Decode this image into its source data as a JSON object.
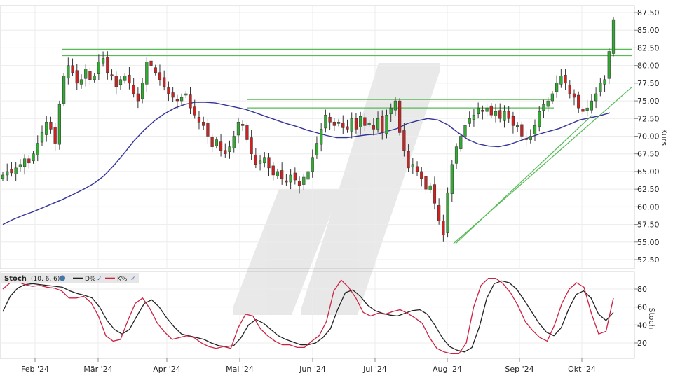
{
  "chart_data": [
    {
      "type": "candlestick",
      "title": "",
      "ylabel": "Kurs",
      "ylim": [
        51.5,
        88.5
      ],
      "yticks": [
        52.5,
        55,
        57.5,
        60,
        62.5,
        65,
        67.5,
        70,
        72.5,
        75,
        77.5,
        80,
        82.5,
        85,
        87.5
      ],
      "ytick_labels": [
        "52.50",
        "55.00",
        "57.50",
        "60.00",
        "62.50",
        "65.00",
        "67.50",
        "70.00",
        "72.50",
        "75.00",
        "77.50",
        "80.00",
        "82.50",
        "85.00",
        "87.50"
      ],
      "xlabels": [
        "Feb '24",
        "Mär '24",
        "Apr '24",
        "Mai '24",
        "Jun '24",
        "Jul '24",
        "Aug '24",
        "Sep '24",
        "Okt '24"
      ],
      "grid": true,
      "colors": {
        "up": "#33aa33",
        "down": "#cc2222",
        "ma": "#333399",
        "lines": "#55bb55"
      },
      "close_series": [
        64.5,
        65.0,
        64.8,
        65.5,
        66.0,
        66.8,
        66.2,
        67.5,
        69.0,
        70.5,
        72.0,
        71.0,
        69.0,
        74.5,
        78.5,
        80.0,
        79.0,
        77.5,
        78.0,
        79.5,
        78.0,
        78.5,
        80.5,
        81.0,
        79.0,
        78.5,
        77.0,
        78.0,
        78.5,
        77.5,
        76.0,
        75.0,
        77.5,
        80.5,
        80.0,
        79.0,
        78.0,
        77.0,
        76.0,
        75.5,
        75.0,
        75.5,
        76.0,
        74.0,
        73.0,
        72.0,
        71.5,
        70.0,
        68.5,
        69.5,
        68.0,
        67.5,
        68.5,
        70.0,
        72.0,
        71.5,
        69.5,
        67.5,
        66.0,
        66.5,
        67.0,
        65.5,
        64.5,
        65.0,
        64.0,
        63.5,
        64.5,
        63.8,
        63.0,
        64.2,
        65.0,
        67.0,
        69.0,
        71.0,
        73.0,
        72.0,
        71.5,
        72.0,
        71.2,
        71.0,
        72.5,
        71.0,
        72.8,
        71.5,
        71.8,
        71.0,
        72.5,
        70.5,
        73.0,
        74.0,
        75.0,
        70.5,
        68.0,
        65.5,
        66.0,
        65.0,
        64.0,
        62.5,
        63.0,
        60.5,
        58.0,
        56.0,
        62.0,
        66.0,
        68.5,
        70.0,
        71.5,
        72.5,
        73.0,
        74.0,
        73.5,
        74.0,
        73.0,
        73.5,
        72.5,
        73.5,
        72.5,
        71.5,
        71.5,
        70.0,
        69.5,
        70.0,
        71.5,
        73.5,
        74.5,
        75.0,
        76.0,
        77.5,
        78.5,
        77.5,
        76.0,
        75.5,
        74.0,
        73.5,
        74.0,
        75.0,
        76.0,
        77.5,
        78.0,
        82.0,
        86.5
      ],
      "ma_series": [
        57.5,
        58.2,
        58.8,
        59.3,
        59.9,
        60.5,
        61.1,
        61.8,
        62.5,
        63.3,
        64.4,
        65.9,
        67.6,
        69.4,
        70.9,
        72.2,
        73.2,
        74.0,
        74.5,
        74.8,
        74.8,
        74.7,
        74.4,
        74.1,
        73.8,
        73.3,
        72.8,
        72.3,
        71.8,
        71.4,
        70.9,
        70.5,
        70.1,
        69.8,
        69.8,
        70.0,
        70.2,
        70.3,
        70.7,
        71.1,
        71.8,
        72.2,
        72.5,
        72.3,
        71.6,
        70.5,
        69.5,
        68.9,
        68.6,
        68.5,
        68.8,
        69.3,
        69.8,
        70.3,
        70.7,
        71.1,
        71.7,
        72.3,
        72.6,
        72.9,
        73.3
      ],
      "horizontal_lines": [
        82.3,
        81.4,
        75.2,
        74.0
      ],
      "trend_lines": true
    },
    {
      "type": "line",
      "title": "",
      "legend_title": "Stoch",
      "legend_params": "(10, 6, 6)",
      "legend_entries": [
        "D%",
        "K%"
      ],
      "ylabel": "Stoch",
      "ylim": [
        5,
        95
      ],
      "yticks": [
        20,
        40,
        60,
        80
      ],
      "ytick_labels": [
        "20",
        "40",
        "60",
        "80"
      ],
      "grid": true,
      "series": [
        {
          "name": "D%",
          "color": "#222222",
          "values": [
            55,
            72,
            81,
            85,
            86,
            85,
            84,
            83,
            82,
            78,
            75,
            73,
            70,
            60,
            45,
            35,
            30,
            35,
            50,
            64,
            68,
            60,
            48,
            38,
            30,
            28,
            26,
            24,
            20,
            17,
            16,
            17,
            26,
            40,
            46,
            42,
            35,
            28,
            24,
            21,
            18,
            18,
            20,
            26,
            36,
            58,
            76,
            79,
            72,
            62,
            56,
            53,
            51,
            50,
            53,
            56,
            57,
            52,
            40,
            26,
            16,
            12,
            10,
            15,
            38,
            70,
            86,
            89,
            87,
            80,
            68,
            55,
            42,
            32,
            28,
            37,
            58,
            74,
            78,
            70,
            52,
            45,
            54
          ]
        },
        {
          "name": "K%",
          "color": "#cc2244",
          "values": [
            80,
            87,
            88,
            85,
            83,
            84,
            82,
            81,
            78,
            70,
            70,
            72,
            65,
            50,
            28,
            22,
            24,
            45,
            64,
            70,
            58,
            42,
            32,
            24,
            26,
            28,
            26,
            20,
            16,
            14,
            16,
            14,
            37,
            52,
            50,
            36,
            28,
            22,
            18,
            18,
            15,
            15,
            22,
            28,
            44,
            78,
            90,
            82,
            70,
            54,
            50,
            53,
            52,
            55,
            57,
            53,
            48,
            42,
            26,
            14,
            10,
            8,
            8,
            20,
            60,
            84,
            92,
            92,
            86,
            76,
            62,
            44,
            34,
            26,
            22,
            40,
            64,
            80,
            87,
            82,
            53,
            30,
            33,
            70
          ]
        }
      ]
    }
  ]
}
